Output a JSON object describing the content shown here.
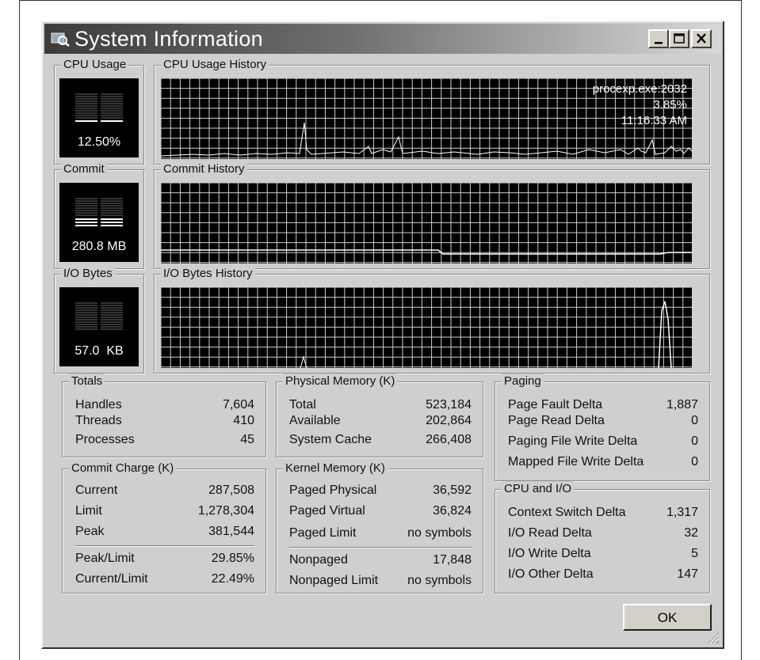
{
  "window": {
    "title": "System Information",
    "minimize_glyph": "_",
    "ok_label": "OK"
  },
  "cpu": {
    "usage_label": "CPU Usage",
    "usage_value": "12.50%",
    "history_label": "CPU Usage History",
    "tooltip": {
      "process": "procexp.exe:2032",
      "percent": "3.85%",
      "time": "11:16:33 AM"
    }
  },
  "commit": {
    "label": "Commit",
    "value": "280.8 MB",
    "history_label": "Commit History"
  },
  "io": {
    "label": "I/O Bytes",
    "value": "57.0  KB",
    "history_label": "I/O Bytes History"
  },
  "totals": {
    "label": "Totals",
    "rows": [
      {
        "k": "Handles",
        "v": "7,604"
      },
      {
        "k": "Threads",
        "v": "410"
      },
      {
        "k": "Processes",
        "v": "45"
      }
    ]
  },
  "commit_charge": {
    "label": "Commit Charge (K)",
    "rows": [
      {
        "k": "Current",
        "v": "287,508"
      },
      {
        "k": "Limit",
        "v": "1,278,304"
      },
      {
        "k": "Peak",
        "v": "381,544"
      },
      {
        "k": "Peak/Limit",
        "v": "29.85%"
      },
      {
        "k": "Current/Limit",
        "v": "22.49%"
      }
    ]
  },
  "physical_memory": {
    "label": "Physical Memory (K)",
    "rows": [
      {
        "k": "Total",
        "v": "523,184"
      },
      {
        "k": "Available",
        "v": "202,864"
      },
      {
        "k": "System Cache",
        "v": "266,408"
      }
    ]
  },
  "kernel_memory": {
    "label": "Kernel Memory (K)",
    "rows": [
      {
        "k": "Paged Physical",
        "v": "36,592"
      },
      {
        "k": "Paged Virtual",
        "v": "36,824"
      },
      {
        "k": "Paged Limit",
        "v": "no symbols"
      },
      {
        "k": "Nonpaged",
        "v": "17,848"
      },
      {
        "k": "Nonpaged Limit",
        "v": "no symbols"
      }
    ]
  },
  "paging": {
    "label": "Paging",
    "rows": [
      {
        "k": "Page Fault Delta",
        "v": "1,887"
      },
      {
        "k": "Page Read Delta",
        "v": "0"
      },
      {
        "k": "Paging File Write Delta",
        "v": "0"
      },
      {
        "k": "Mapped File Write Delta",
        "v": "0"
      }
    ]
  },
  "cpu_io": {
    "label": "CPU and I/O",
    "rows": [
      {
        "k": "Context Switch Delta",
        "v": "1,317"
      },
      {
        "k": "I/O Read Delta",
        "v": "32"
      },
      {
        "k": "I/O Write Delta",
        "v": "5"
      },
      {
        "k": "I/O Other Delta",
        "v": "147"
      }
    ]
  },
  "icons": {
    "title": "procexp-app-icon",
    "minimize": "minimize-icon",
    "maximize": "maximize-icon",
    "close": "close-icon",
    "grip": "resize-grip-icon"
  },
  "colors": {
    "graph_bg": "#000000",
    "grid": "#cfcfcf",
    "trace": "#ffffff",
    "window_bg": "#cfcfcf"
  }
}
